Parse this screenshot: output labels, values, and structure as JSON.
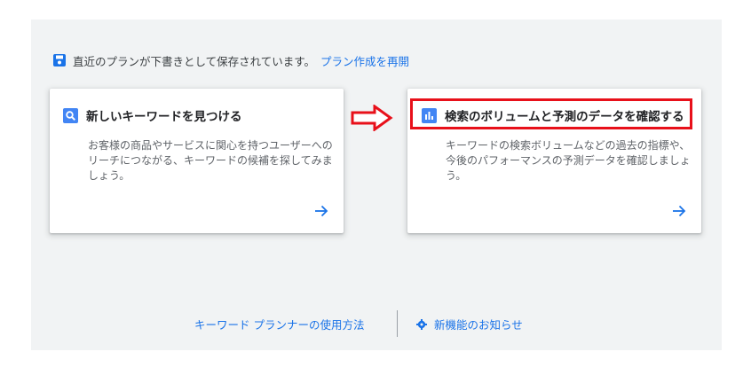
{
  "draft_notice": {
    "text": "直近のプランが下書きとして保存されています。",
    "link_label": "プラン作成を再開",
    "icon": "save-icon"
  },
  "cards": [
    {
      "title": "新しいキーワードを見つける",
      "description": "お客様の商品やサービスに関心を持つユーザーへのリーチにつながる、キーワードの候補を探してみましょう。",
      "icon": "search-icon"
    },
    {
      "title": "検索のボリュームと予測のデータを確認する",
      "description": "キーワードの検索ボリュームなどの過去の指標や、今後のパフォーマンスの予測データを確認しましょう。",
      "icon": "bar-chart-icon"
    }
  ],
  "footer": {
    "help_label": "キーワード プランナーの使用方法",
    "news_label": "新機能のお知らせ"
  },
  "colors": {
    "accent": "#1a73e8",
    "icon_blue": "#4285f4",
    "highlight_red": "#e8101a",
    "panel_bg": "#f1f3f4"
  }
}
